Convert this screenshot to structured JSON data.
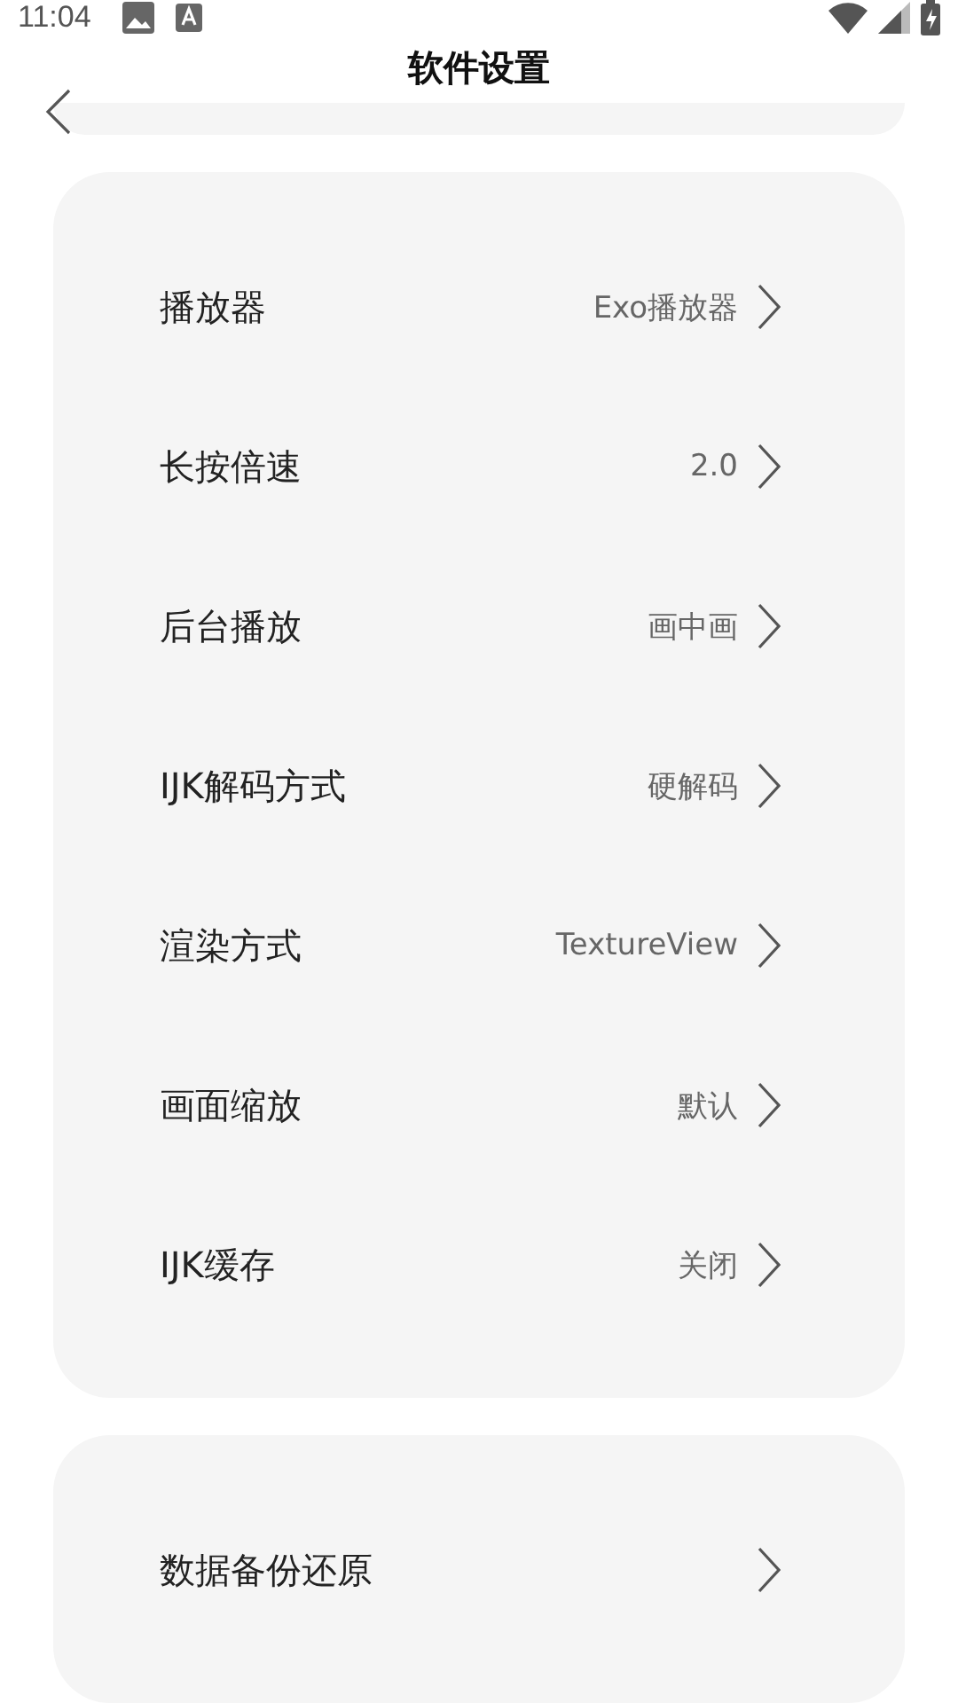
{
  "status_bar": {
    "time": "11:04"
  },
  "header": {
    "title": "软件设置"
  },
  "settings": [
    {
      "label": "播放器",
      "value": "Exo播放器"
    },
    {
      "label": "长按倍速",
      "value": "2.0"
    },
    {
      "label": "后台播放",
      "value": "画中画"
    },
    {
      "label": "IJK解码方式",
      "value": "硬解码"
    },
    {
      "label": "渲染方式",
      "value": "TextureView"
    },
    {
      "label": "画面缩放",
      "value": "默认"
    },
    {
      "label": "IJK缓存",
      "value": "关闭"
    }
  ],
  "next_section": [
    {
      "label": "数据备份还原"
    }
  ]
}
